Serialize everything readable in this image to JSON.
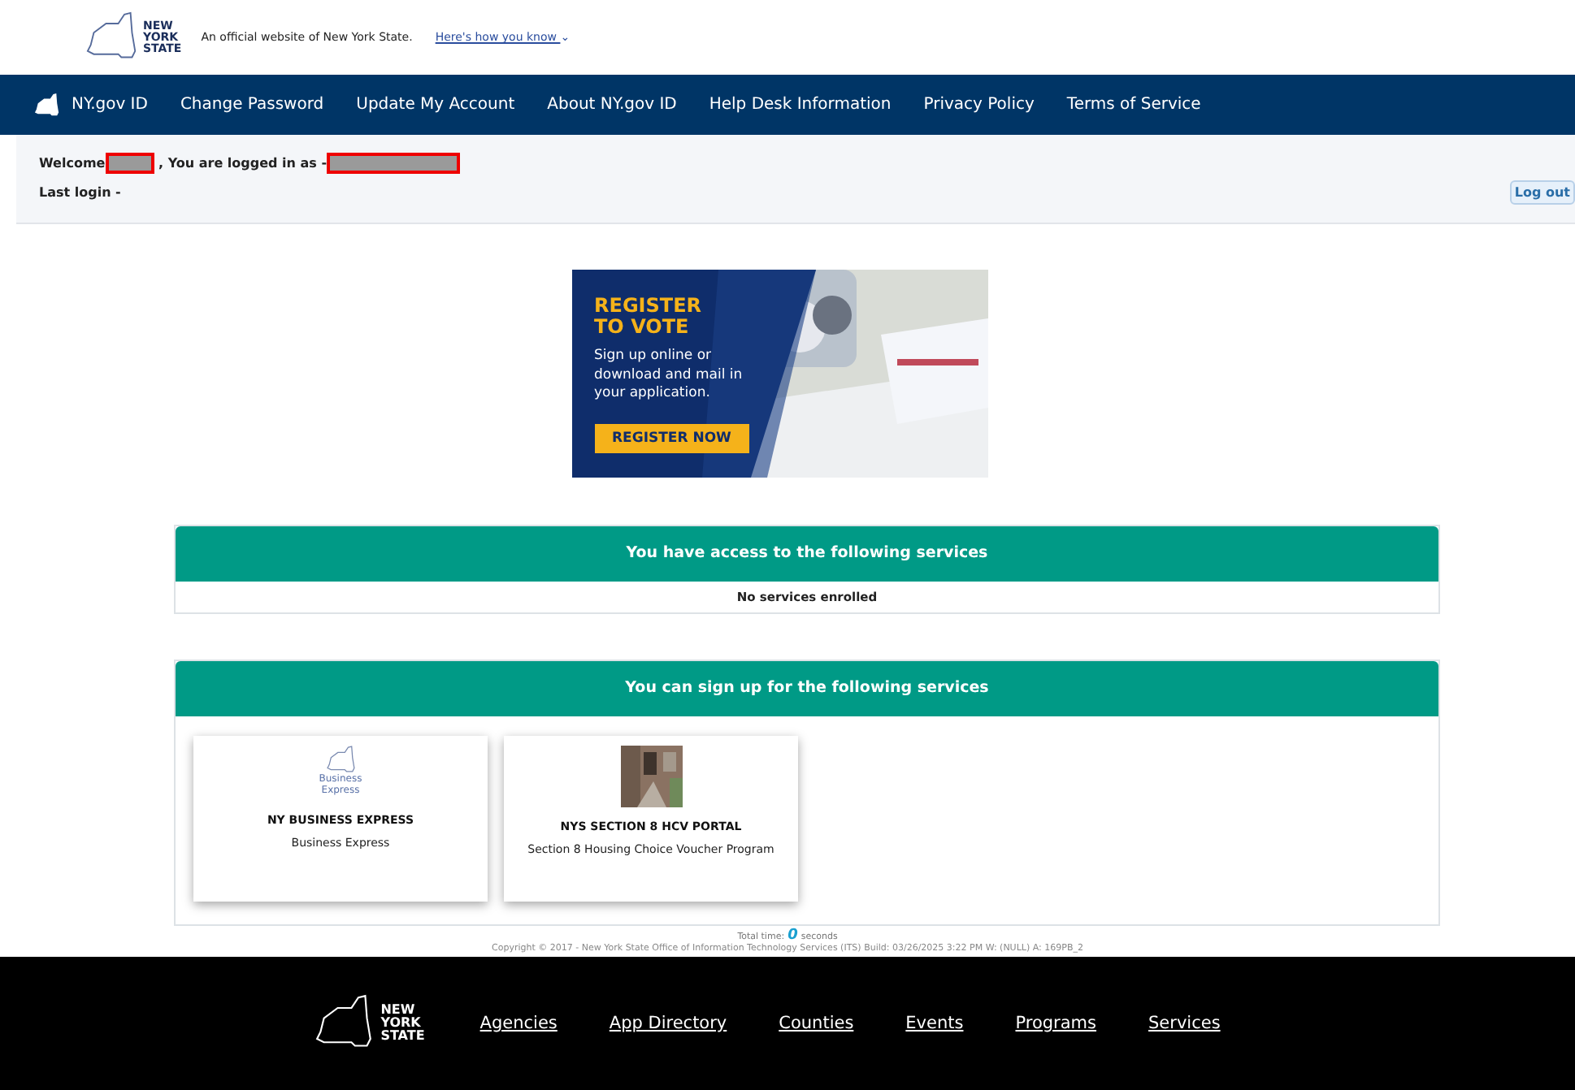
{
  "header": {
    "logo_text": [
      "NEW",
      "YORK",
      "STATE"
    ],
    "official_text": "An official website of New York State.",
    "how_link": "Here's how you know",
    "how_caret": "⌄"
  },
  "navbar": {
    "brand": "NY.gov ID",
    "items": [
      "Change Password",
      "Update My Account",
      "About NY.gov ID",
      "Help Desk Information",
      "Privacy Policy",
      "Terms of Service"
    ]
  },
  "login_bar": {
    "welcome": "Welcome",
    "logged_in_as": ", You are logged in as -",
    "last_login": "Last login -",
    "logout": "Log out"
  },
  "banner": {
    "heading": [
      "REGISTER",
      "TO VOTE"
    ],
    "body": "Sign up online or download and mail in your application.",
    "button": "REGISTER NOW"
  },
  "access_panel": {
    "title": "You have access to the following services",
    "message": "No services enrolled"
  },
  "signup_panel": {
    "title": "You can sign up for the following services",
    "cards": [
      {
        "kind": "logo",
        "logo_text": "Business Express",
        "title": "NY BUSINESS EXPRESS",
        "subtitle": "Business Express"
      },
      {
        "title": "NYS SECTION 8 HCV PORTAL",
        "subtitle": "Section 8 Housing Choice Voucher Program"
      }
    ]
  },
  "total_time": {
    "label": "Total time:",
    "value": "0",
    "unit": "seconds"
  },
  "copyright": "Copyright © 2017 - New York State Office of Information Technology Services (ITS) Build: 03/26/2025 3:22 PM W: (NULL)  A: 169PB_2",
  "footer": {
    "logo_text": [
      "NEW",
      "YORK",
      "STATE"
    ],
    "links": [
      "Agencies",
      "App Directory",
      "Counties",
      "Events",
      "Programs",
      "Services"
    ]
  }
}
